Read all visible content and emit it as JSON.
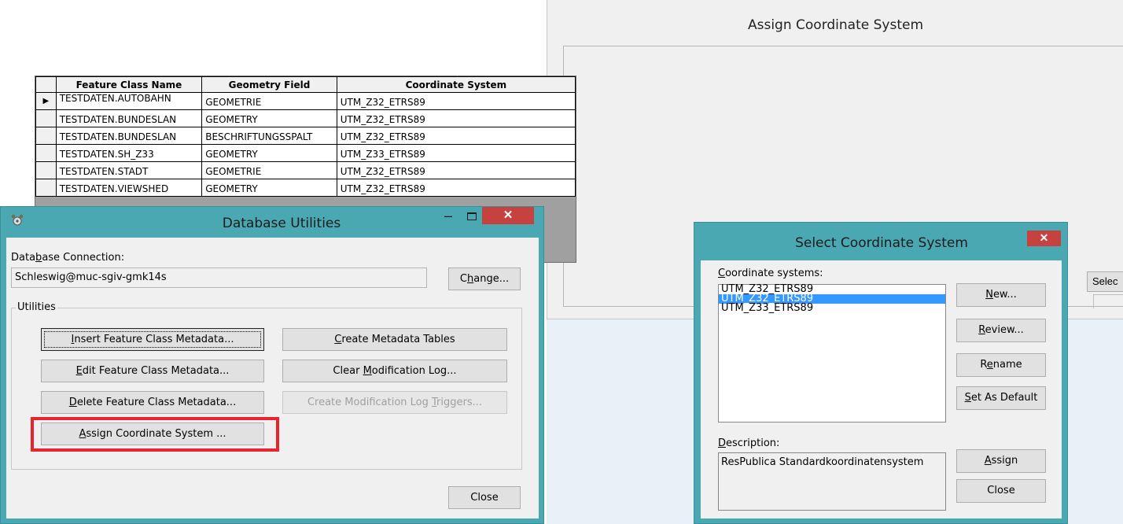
{
  "assign_window": {
    "title": "Assign Coordinate System",
    "columns": [
      "Feature Class Name",
      "Geometry Field",
      "Coordinate System"
    ],
    "rows": [
      {
        "name": "TESTDATEN.AUTOBAHN",
        "field": "GEOMETRIE",
        "cs": "UTM_Z32_ETRS89",
        "current": true
      },
      {
        "name": "TESTDATEN.BUNDESLAN",
        "field": "GEOMETRY",
        "cs": "UTM_Z32_ETRS89"
      },
      {
        "name": "TESTDATEN.BUNDESLAN",
        "field": "BESCHRIFTUNGSSPALT",
        "cs": "UTM_Z32_ETRS89"
      },
      {
        "name": "TESTDATEN.SH_Z33",
        "field": "GEOMETRY",
        "cs": "UTM_Z33_ETRS89"
      },
      {
        "name": "TESTDATEN.STADT",
        "field": "GEOMETRIE",
        "cs": "UTM_Z32_ETRS89"
      },
      {
        "name": "TESTDATEN.VIEWSHED",
        "field": "GEOMETRY",
        "cs": "UTM_Z32_ETRS89"
      }
    ],
    "select_button": "Selec",
    "row_pointer_icon": "triangle-right-icon"
  },
  "db_utilities": {
    "title": "Database Utilities",
    "window_buttons": {
      "minimize": "–",
      "close": "✕"
    },
    "connection_label_pre": "Data",
    "connection_label_accel": "b",
    "connection_label_post": "ase Connection:",
    "connection_value": "Schleswig@muc-sgiv-gmk14s",
    "change_pre": "C",
    "change_accel": "h",
    "change_post": "ange...",
    "utilities_label": "Utilities",
    "buttons": {
      "insert_accel": "I",
      "insert_post": "nsert Feature Class Metadata...",
      "edit_accel": "E",
      "edit_post": "dit Feature Class Metadata...",
      "delete_accel": "D",
      "delete_post": "elete Feature Class Metadata...",
      "assign_accel": "A",
      "assign_post": "ssign Coordinate System ...",
      "create_accel": "C",
      "create_post": "reate Metadata Tables",
      "clear_pre": "Clear ",
      "clear_accel": "M",
      "clear_post": "odification Log...",
      "triggers_pre": "Create Modification Log ",
      "triggers_accel": "T",
      "triggers_post": "riggers...",
      "close": "Close"
    },
    "highlight_color": "#e8242c"
  },
  "select_dialog": {
    "title": "Select Coordinate System",
    "close_glyph": "✕",
    "list_label_accel": "C",
    "list_label_post": "oordinate systems:",
    "items": [
      "UTM_Z32_ETRS89",
      "UTM_Z32_ETRS89",
      "UTM_Z33_ETRS89"
    ],
    "selected_index": 1,
    "new_accel": "N",
    "new_post": "ew...",
    "review_accel": "R",
    "review_post": "eview...",
    "rename_pre": "R",
    "rename_accel": "e",
    "rename_post": "name",
    "default_accel": "S",
    "default_post": "et As Default",
    "desc_label_accel": "D",
    "desc_label_post": "escription:",
    "description": "ResPublica Standardkoordinatensystem",
    "assign_accel": "A",
    "assign_post": "ssign",
    "close": "Close"
  },
  "colors": {
    "window_frame": "#4aa8b3",
    "close_red": "#c7413f",
    "selection_blue": "#3399ff"
  }
}
